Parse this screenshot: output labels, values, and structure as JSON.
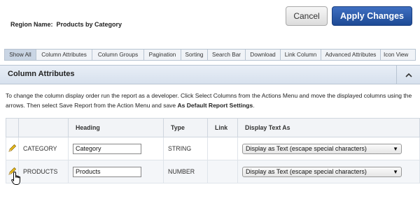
{
  "region": {
    "label": "Region Name:",
    "value": "Products by Category"
  },
  "buttons": {
    "cancel": "Cancel",
    "apply": "Apply Changes"
  },
  "tabs": [
    "Show All",
    "Column Attributes",
    "Column Groups",
    "Pagination",
    "Sorting",
    "Search Bar",
    "Download",
    "Link Column",
    "Advanced Attributes",
    "Icon View"
  ],
  "active_tab": "Show All",
  "panel": {
    "title": "Column Attributes",
    "collapse_icon": "chevron-up-icon"
  },
  "instructions": {
    "text": "To change the column display order run the report as a developer. Click Select Columns from the Actions Menu and move the displayed columns using the arrows. Then select Save Report from the Action Menu and save ",
    "bold": "As Default Report Settings",
    "end": "."
  },
  "table": {
    "headers": {
      "heading": "Heading",
      "type": "Type",
      "link": "Link",
      "display": "Display Text As"
    },
    "rows": [
      {
        "column": "CATEGORY",
        "heading": "Category",
        "type": "STRING",
        "link": "",
        "display": "Display as Text (escape special characters)"
      },
      {
        "column": "PRODUCTS",
        "heading": "Products",
        "type": "NUMBER",
        "link": "",
        "display": "Display as Text (escape special characters)"
      }
    ]
  },
  "colors": {
    "apply_button": "#2a58a8",
    "panel_header": "#dfe7f1",
    "active_tab": "#c9d5e4"
  }
}
